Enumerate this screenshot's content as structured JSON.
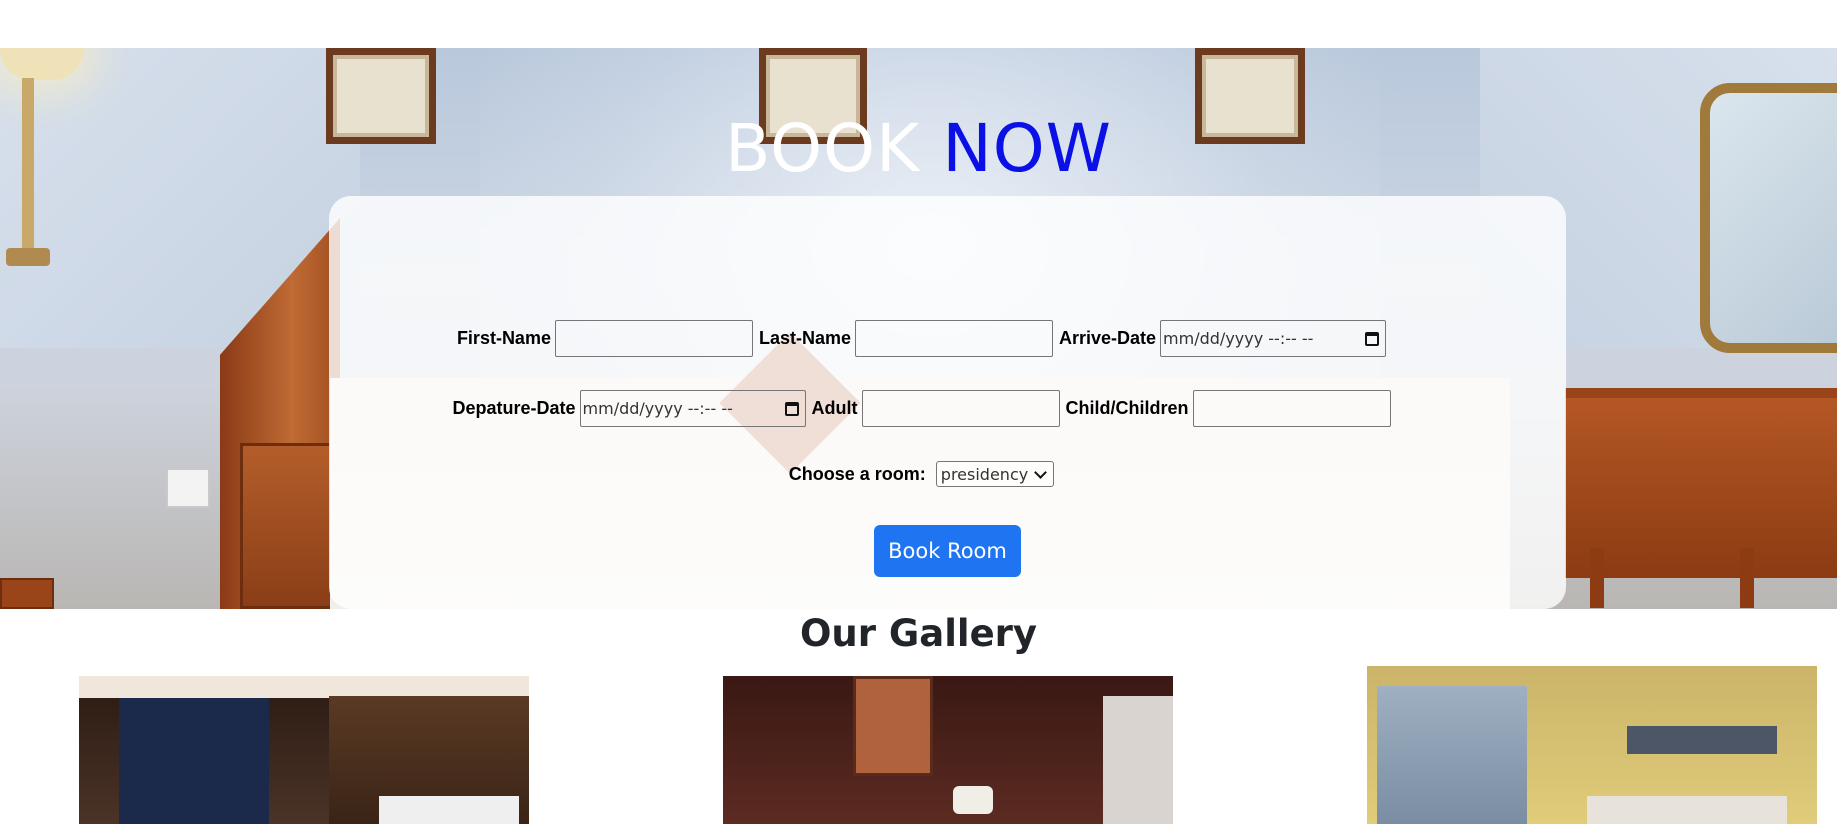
{
  "hero": {
    "title_word1": "BOOK",
    "title_word2": "NOW",
    "title_word2_color": "#0a10e6",
    "background_image": "hotel-bedroom-photo"
  },
  "form": {
    "first_name_label": "First-Name",
    "first_name_value": "",
    "last_name_label": "Last-Name",
    "last_name_value": "",
    "arrive_date_label": "Arrive-Date",
    "arrive_date_placeholder": "mm/dd/yyyy --:-- --",
    "departure_date_label": "Depature-Date",
    "departure_date_placeholder": "mm/dd/yyyy --:-- --",
    "adult_label": "Adult",
    "adult_value": "",
    "children_label": "Child/Children",
    "children_value": "",
    "room_label": "Choose a room:",
    "room_selected": "presidency",
    "submit_label": "Book Room",
    "submit_color": "#1f74f2"
  },
  "gallery": {
    "title": "Our Gallery",
    "images": [
      "hotel-room-city-view",
      "hotel-room-dark-wood",
      "hotel-room-window-city"
    ]
  }
}
